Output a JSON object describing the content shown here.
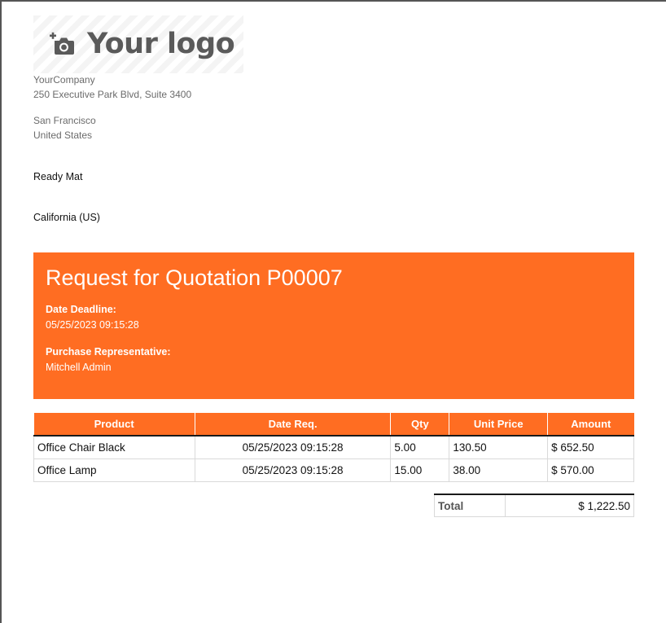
{
  "logo": {
    "text": "Your logo",
    "icon": "camera-plus-icon"
  },
  "company": {
    "name": "YourCompany",
    "street": "250 Executive Park Blvd, Suite 3400",
    "city": "San Francisco",
    "country": "United States"
  },
  "vendor": {
    "name": "Ready Mat",
    "region": "California (US)"
  },
  "rfq": {
    "title": "Request for Quotation P00007",
    "deadline_label": "Date Deadline:",
    "deadline_value": "05/25/2023 09:15:28",
    "rep_label": "Purchase Representative:",
    "rep_value": "Mitchell Admin"
  },
  "table": {
    "headers": [
      "Product",
      "Date Req.",
      "Qty",
      "Unit Price",
      "Amount"
    ],
    "rows": [
      [
        "Office Chair Black",
        "05/25/2023 09:15:28",
        "5.00",
        "130.50",
        "$ 652.50"
      ],
      [
        "Office Lamp",
        "05/25/2023 09:15:28",
        "15.00",
        "38.00",
        "$ 570.00"
      ]
    ]
  },
  "totals": {
    "label": "Total",
    "value": "$ 1,222.50"
  },
  "colors": {
    "accent": "#ff6d22",
    "text_muted": "#6b6b6b"
  }
}
